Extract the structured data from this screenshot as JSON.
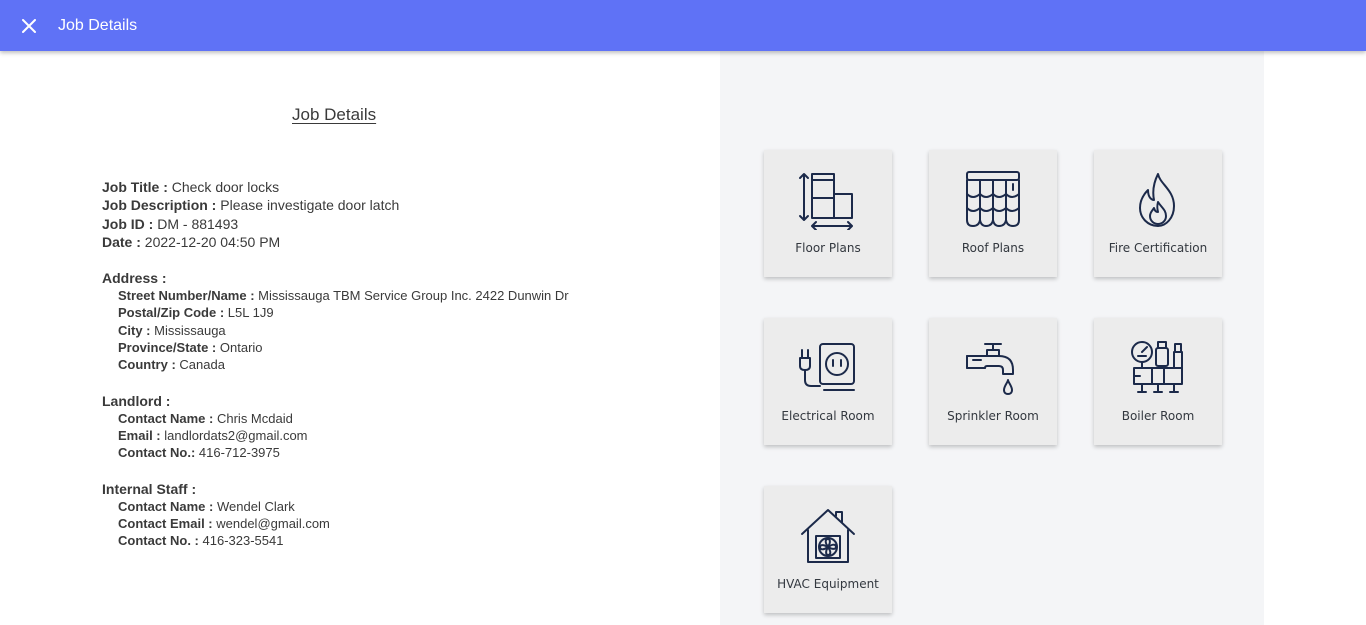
{
  "header": {
    "title": "Job Details",
    "close_icon": "close-icon",
    "color": "#5f72f6"
  },
  "main": {
    "heading": "Job Details",
    "job": [
      {
        "label": "Job Title :",
        "value": "Check door locks"
      },
      {
        "label": "Job Description :",
        "value": "Please investigate door latch"
      },
      {
        "label": "Job ID :",
        "value": "DM - 881493"
      },
      {
        "label": "Date :",
        "value": "2022-12-20 04:50 PM"
      }
    ],
    "address": {
      "title": "Address :",
      "fields": [
        {
          "label": "Street Number/Name :",
          "value": "Mississauga TBM Service Group Inc. 2422 Dunwin Dr"
        },
        {
          "label": "Postal/Zip Code :",
          "value": "L5L 1J9"
        },
        {
          "label": "City :",
          "value": "Mississauga"
        },
        {
          "label": "Province/State :",
          "value": "Ontario"
        },
        {
          "label": "Country :",
          "value": "Canada"
        }
      ]
    },
    "landlord": {
      "title": "Landlord :",
      "fields": [
        {
          "label": "Contact Name :",
          "value": "Chris Mcdaid"
        },
        {
          "label": "Email :",
          "value": "landlordats2@gmail.com"
        },
        {
          "label": "Contact No.:",
          "value": "416-712-3975"
        }
      ]
    },
    "staff": {
      "title": "Internal Staff :",
      "fields": [
        {
          "label": "Contact Name :",
          "value": "Wendel Clark"
        },
        {
          "label": "Contact Email :",
          "value": "wendel@gmail.com"
        },
        {
          "label": "Contact No. :",
          "value": "416-323-5541"
        }
      ]
    }
  },
  "tiles": [
    {
      "label": "Floor Plans",
      "icon": "floor-plans-icon"
    },
    {
      "label": "Roof Plans",
      "icon": "roof-plans-icon"
    },
    {
      "label": "Fire Certification",
      "icon": "fire-icon"
    },
    {
      "label": "Electrical Room",
      "icon": "electrical-outlet-icon"
    },
    {
      "label": "Sprinkler Room",
      "icon": "faucet-icon"
    },
    {
      "label": "Boiler Room",
      "icon": "boiler-icon"
    },
    {
      "label": "HVAC Equipment",
      "icon": "hvac-house-fan-icon"
    }
  ]
}
